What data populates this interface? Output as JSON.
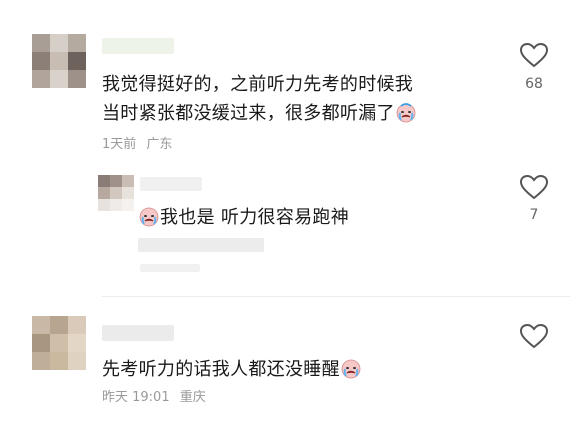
{
  "comments": [
    {
      "text_line1": "我觉得挺好的，之前听力先考的时候我",
      "text_line2": "当时紧张都没缓过来，很多都听漏了",
      "time": "1天前",
      "location": "广东",
      "likes": "68",
      "emoji": "crying-face-emoji"
    },
    {
      "text": "我也是 听力很容易跑神",
      "likes": "7",
      "emoji": "crying-face-emoji"
    },
    {
      "text": "先考听力的话我人都还没睡醒",
      "time": "昨天 19:01",
      "location": "重庆",
      "emoji": "crying-face-emoji"
    }
  ],
  "colors": {
    "text": "#1a1a1a",
    "meta": "#9a9a9a",
    "icon": "#555555"
  }
}
